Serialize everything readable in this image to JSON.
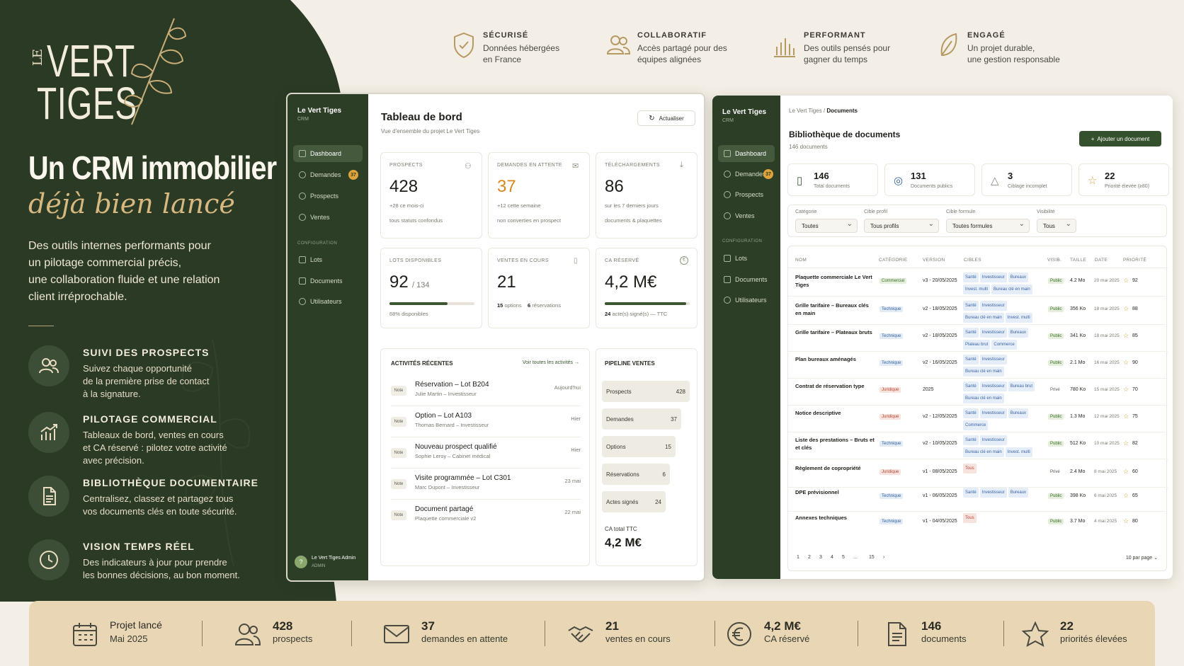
{
  "brand": {
    "logo_le": "LE",
    "logo_line1": "VERT",
    "logo_line2": "TIGES"
  },
  "hero": {
    "title": "Un CRM immobilier",
    "subtitle": "déjà bien lancé",
    "intro": [
      "Des outils internes performants pour",
      "un pilotage commercial précis,",
      "une collaboration fluide et une relation",
      "client irréprochable."
    ]
  },
  "features": [
    {
      "icon": "users-icon",
      "title": "SUIVI DES PROSPECTS",
      "desc": [
        "Suivez chaque opportunité",
        "de la première prise de contact",
        "à la signature."
      ]
    },
    {
      "icon": "chart-up-icon",
      "title": "PILOTAGE COMMERCIAL",
      "desc": [
        "Tableaux de bord, ventes en cours",
        "et CA réservé : pilotez votre activité",
        "avec précision."
      ]
    },
    {
      "icon": "document-icon",
      "title": "BIBLIOTHÈQUE DOCUMENTAIRE",
      "desc": [
        "Centralisez, classez et partagez tous",
        "vos documents clés en toute sécurité."
      ]
    },
    {
      "icon": "clock-icon",
      "title": "VISION TEMPS RÉEL",
      "desc": [
        "Des indicateurs à jour pour prendre",
        "les bonnes décisions, au bon moment."
      ]
    }
  ],
  "top_features": [
    {
      "icon": "shield-check-icon",
      "title": "SÉCURISÉ",
      "desc": [
        "Données hébergées",
        "en France"
      ]
    },
    {
      "icon": "users-icon",
      "title": "COLLABORATIF",
      "desc": [
        "Accès partagé pour des",
        "équipes alignées"
      ]
    },
    {
      "icon": "bar-chart-icon",
      "title": "PERFORMANT",
      "desc": [
        "Des outils pensés pour",
        "gagner du temps"
      ]
    },
    {
      "icon": "leaf-icon",
      "title": "ENGAGÉ",
      "desc": [
        "Un projet durable,",
        "une gestion responsable"
      ]
    }
  ],
  "sidebar": {
    "brand": "Le Vert Tiges",
    "sub": "CRM",
    "items": [
      {
        "label": "Dashboard",
        "icon": "grid-icon"
      },
      {
        "label": "Demandes",
        "icon": "users-icon",
        "badge": "37"
      },
      {
        "label": "Prospects",
        "icon": "users-icon"
      },
      {
        "label": "Ventes",
        "icon": "euro-icon"
      }
    ],
    "config_label": "CONFIGURATION",
    "config_items": [
      {
        "label": "Lots",
        "icon": "box-icon"
      },
      {
        "label": "Documents",
        "icon": "document-icon"
      },
      {
        "label": "Utilisateurs",
        "icon": "gear-icon"
      }
    ],
    "user_name": "Le Vert Tiges Admin",
    "user_role": "ADMIN",
    "user_avatar": "?"
  },
  "dashboard": {
    "title": "Tableau de bord",
    "subtitle": "Vue d'ensemble du projet Le Vert Tiges",
    "refresh": "Actualiser",
    "kpis": [
      {
        "label": "PROSPECTS",
        "value": "428",
        "line1": "+28 ce mois-ci",
        "line2": "tous statuts confondus"
      },
      {
        "label": "DEMANDES EN ATTENTE",
        "value": "37",
        "line1": "+12 cette semaine",
        "line2": "non converties en prospect"
      },
      {
        "label": "TÉLÉCHARGEMENTS",
        "value": "86",
        "line1": "sur les 7 derniers jours",
        "line2": "documents & plaquettes"
      }
    ],
    "lots": {
      "label": "LOTS DISPONIBLES",
      "value": "92",
      "total": "/ 134",
      "note": "68% disponibles",
      "progress": 0.68
    },
    "ventes": {
      "label": "VENTES EN COURS",
      "value": "21",
      "options_n": "15",
      "options_l": "options",
      "resa_n": "6",
      "resa_l": "réservations"
    },
    "ca": {
      "label": "CA RÉSERVÉ",
      "value": "4,2 M€",
      "note_n": "24",
      "note": "acte(s) signé(s) — TTC",
      "progress": 0.96
    },
    "activities": {
      "title": "ACTIVITÉS RÉCENTES",
      "link": "Voir toutes les activités →",
      "tag": "Note",
      "items": [
        {
          "title": "Réservation – Lot B204",
          "sub": "Julie Martin – Investisseur",
          "date": "Aujourd'hui"
        },
        {
          "title": "Option – Lot A103",
          "sub": "Thomas Bernard – Investisseur",
          "date": "Hier"
        },
        {
          "title": "Nouveau prospect qualifié",
          "sub": "Sophie Leroy – Cabinet médical",
          "date": "Hier"
        },
        {
          "title": "Visite programmée – Lot C301",
          "sub": "Marc Dupont – Investisseur",
          "date": "23 mai"
        },
        {
          "title": "Document partagé",
          "sub": "Plaquette commerciale v2",
          "date": "22 mai"
        }
      ]
    },
    "pipeline": {
      "title": "PIPELINE VENTES",
      "stages": [
        {
          "label": "Prospects",
          "value": 428
        },
        {
          "label": "Demandes",
          "value": 37
        },
        {
          "label": "Options",
          "value": 15
        },
        {
          "label": "Réservations",
          "value": 6
        },
        {
          "label": "Actes signés",
          "value": 24
        }
      ],
      "total_label": "CA total TTC",
      "total_value": "4,2 M€"
    }
  },
  "documents": {
    "breadcrumb_root": "Le Vert Tiges",
    "breadcrumb_current": "Documents",
    "title": "Bibliothèque de documents",
    "count": "146 documents",
    "add_button": "Ajouter un document",
    "stats": [
      {
        "icon": "document-icon",
        "value": "146",
        "label": "Total documents"
      },
      {
        "icon": "globe-icon",
        "value": "131",
        "label": "Documents publics"
      },
      {
        "icon": "warning-icon",
        "value": "3",
        "label": "Ciblage incomplet"
      },
      {
        "icon": "star-icon",
        "value": "22",
        "label": "Priorité élevée (≥80)"
      }
    ],
    "filters": [
      {
        "label": "Catégorie",
        "value": "Toutes"
      },
      {
        "label": "Cible profil",
        "value": "Tous profils"
      },
      {
        "label": "Cible formule",
        "value": "Toutes formules"
      },
      {
        "label": "Visibilité",
        "value": "Tous"
      }
    ],
    "columns": [
      "NOM",
      "CATÉGORIE",
      "VERSION",
      "CIBLES",
      "VISIB.",
      "TAILLE",
      "DATE",
      "PRIORITÉ"
    ],
    "rows": [
      {
        "name": "Plaquette commerciale Le Vert Tiges",
        "cat": "Commercial",
        "ver": "v3 - 20/05/2025",
        "targets": [
          "Santé",
          "Investisseur",
          "Bureaux",
          "Invest. multi",
          "Bureau clé en main"
        ],
        "vis": "Public",
        "size": "4.2 Mo",
        "date": "20 mai 2025",
        "prio": "92"
      },
      {
        "name": "Grille tarifaire – Bureaux clés en main",
        "cat": "Technique",
        "ver": "v2 - 18/05/2025",
        "targets": [
          "Santé",
          "Investisseur",
          "Bureau clé en main",
          "Invest. multi"
        ],
        "vis": "Public",
        "size": "356 Ko",
        "date": "18 mai 2025",
        "prio": "88"
      },
      {
        "name": "Grille tarifaire – Plateaux bruts",
        "cat": "Technique",
        "ver": "v2 - 18/05/2025",
        "targets": [
          "Santé",
          "Investisseur",
          "Bureaux",
          "Plateau brut",
          "Commerce"
        ],
        "vis": "Public",
        "size": "341 Ko",
        "date": "18 mai 2025",
        "prio": "85"
      },
      {
        "name": "Plan bureaux aménagés",
        "cat": "Technique",
        "ver": "v2 - 16/05/2025",
        "targets": [
          "Santé",
          "Investisseur",
          "Bureau clé en main"
        ],
        "vis": "Public",
        "size": "2.1 Mo",
        "date": "16 mai 2025",
        "prio": "90"
      },
      {
        "name": "Contrat de réservation type",
        "cat": "Juridique",
        "ver": "2025",
        "targets": [
          "Santé",
          "Investisseur",
          "Bureau brut",
          "Bureau clé en main"
        ],
        "vis": "Privé",
        "size": "780 Ko",
        "date": "15 mai 2025",
        "prio": "70"
      },
      {
        "name": "Notice descriptive",
        "cat": "Juridique",
        "ver": "v2 - 12/05/2025",
        "targets": [
          "Santé",
          "Investisseur",
          "Bureaux",
          "Commerce"
        ],
        "vis": "Public",
        "size": "1.3 Mo",
        "date": "12 mai 2025",
        "prio": "75"
      },
      {
        "name": "Liste des prestations – Bruts et et clés",
        "cat": "Technique",
        "ver": "v2 - 10/05/2025",
        "targets": [
          "Santé",
          "Investisseur",
          "Bureau clé en main",
          "Invest. multi"
        ],
        "vis": "Public",
        "size": "512 Ko",
        "date": "10 mai 2025",
        "prio": "82"
      },
      {
        "name": "Règlement de copropriété",
        "cat": "Juridique",
        "ver": "v1 - 08/05/2025",
        "targets": [
          "Tous"
        ],
        "vis": "Privé",
        "size": "2.4 Mo",
        "date": "8 mai 2025",
        "prio": "60"
      },
      {
        "name": "DPE prévisionnel",
        "cat": "Technique",
        "ver": "v1 - 06/05/2025",
        "targets": [
          "Santé",
          "Investisseur",
          "Bureaux"
        ],
        "vis": "Public",
        "size": "398 Ko",
        "date": "6 mai 2025",
        "prio": "65"
      },
      {
        "name": "Annexes techniques",
        "cat": "Technique",
        "ver": "v1 - 04/05/2025",
        "targets": [
          "Tous"
        ],
        "vis": "Public",
        "size": "3.7 Mo",
        "date": "4 mai 2025",
        "prio": "80"
      }
    ],
    "pagination": [
      "1",
      "2",
      "3",
      "4",
      "5",
      "...",
      "15",
      "›"
    ],
    "per_page": "10 par page"
  },
  "bottom_stats": [
    {
      "icon": "calendar-icon",
      "value": "Projet lancé",
      "label": "Mai 2025"
    },
    {
      "icon": "users-icon",
      "value": "428",
      "label": "prospects"
    },
    {
      "icon": "mail-icon",
      "value": "37",
      "label": "demandes en attente"
    },
    {
      "icon": "handshake-icon",
      "value": "21",
      "label": "ventes en cours"
    },
    {
      "icon": "euro-icon",
      "value": "4,2 M€",
      "label": "CA réservé"
    },
    {
      "icon": "document-icon",
      "value": "146",
      "label": "documents"
    },
    {
      "icon": "star-icon",
      "value": "22",
      "label": "priorités élevées"
    }
  ],
  "colors": {
    "dark_green": "#2c3e26",
    "gold": "#d6b880",
    "sand": "#e8d6b4",
    "accent_orange": "#d8861d"
  }
}
